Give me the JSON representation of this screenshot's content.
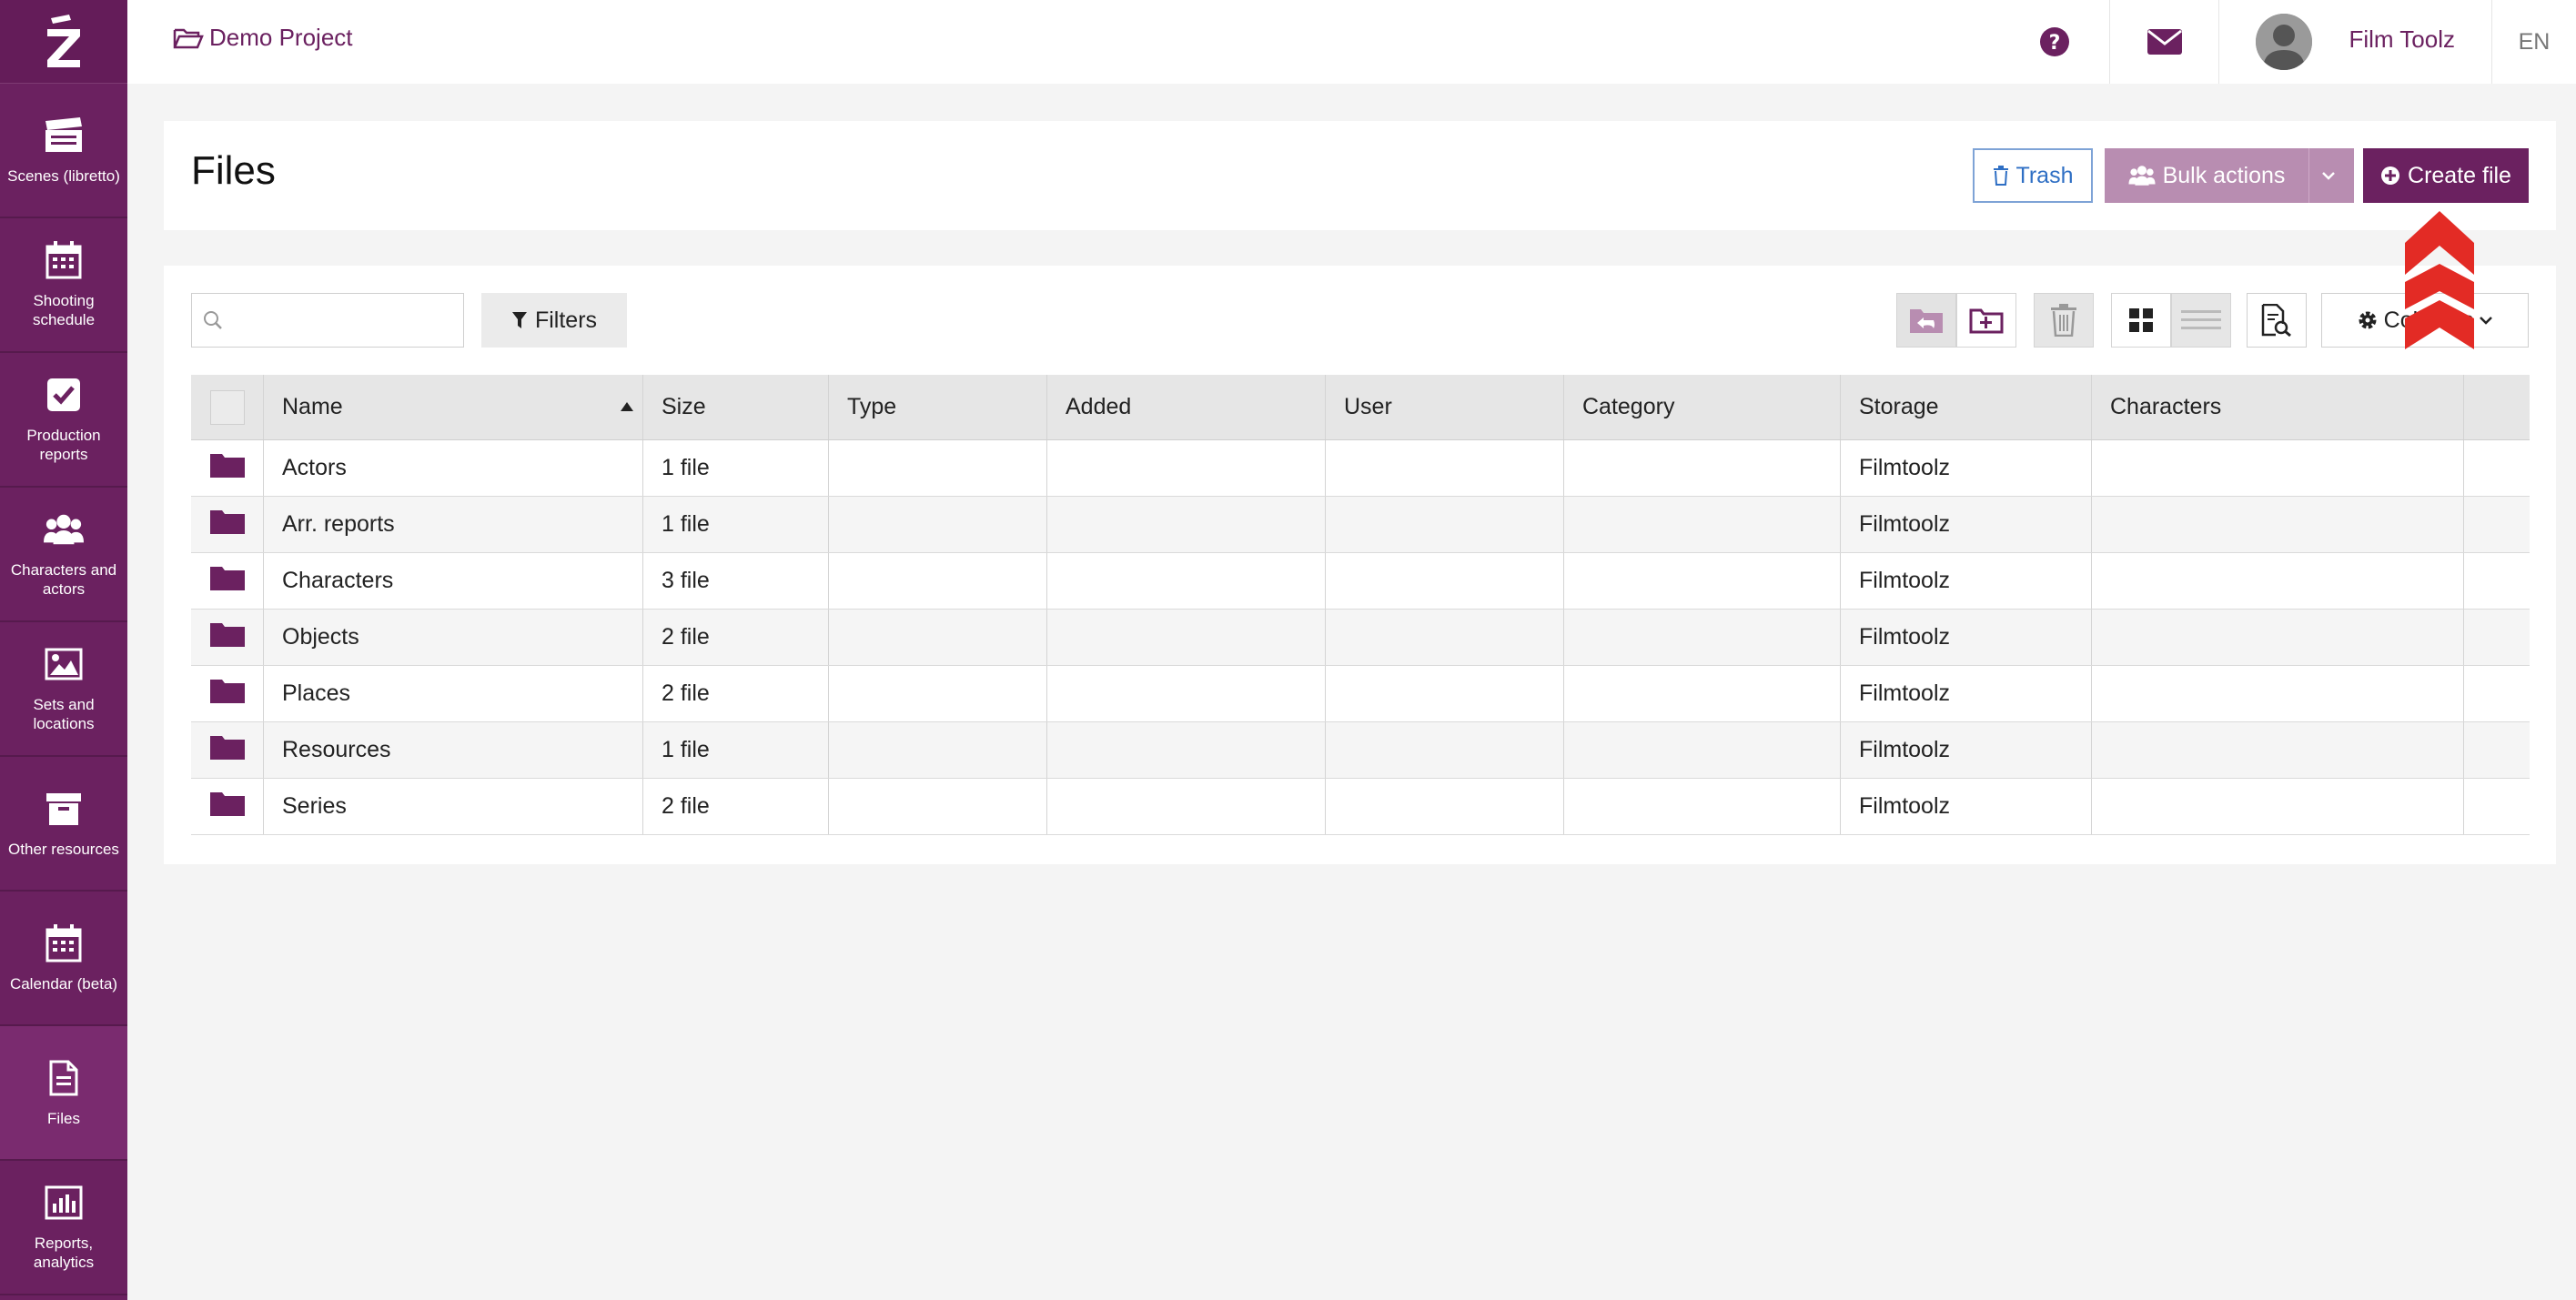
{
  "sidebar": {
    "items": [
      {
        "label": "Scenes (libretto)",
        "icon": "clapperboard-icon"
      },
      {
        "label": "Shooting schedule",
        "icon": "calendar-icon"
      },
      {
        "label": "Production reports",
        "icon": "checkbox-icon"
      },
      {
        "label": "Characters and actors",
        "icon": "users-icon"
      },
      {
        "label": "Sets and locations",
        "icon": "image-icon"
      },
      {
        "label": "Other resources",
        "icon": "archive-box-icon"
      },
      {
        "label": "Calendar (beta)",
        "icon": "calendar-icon"
      },
      {
        "label": "Files",
        "icon": "file-icon",
        "active": true
      },
      {
        "label": "Reports, analytics",
        "icon": "bar-chart-icon"
      }
    ]
  },
  "topbar": {
    "project": "Demo Project",
    "user_name": "Film Toolz",
    "language": "EN"
  },
  "header": {
    "title": "Files",
    "trash_label": "Trash",
    "bulk_actions_label": "Bulk actions",
    "create_file_label": "Create file"
  },
  "toolbar": {
    "search_placeholder": "",
    "filters_label": "Filters",
    "columns_label": "Columns"
  },
  "table": {
    "headers": [
      "Name",
      "Size",
      "Type",
      "Added",
      "User",
      "Category",
      "Storage",
      "Characters"
    ],
    "rows": [
      {
        "name": "Actors",
        "size": "1 file",
        "type": "",
        "added": "",
        "user": "",
        "category": "",
        "storage": "Filmtoolz",
        "characters": ""
      },
      {
        "name": "Arr. reports",
        "size": "1 file",
        "type": "",
        "added": "",
        "user": "",
        "category": "",
        "storage": "Filmtoolz",
        "characters": ""
      },
      {
        "name": "Characters",
        "size": "3 file",
        "type": "",
        "added": "",
        "user": "",
        "category": "",
        "storage": "Filmtoolz",
        "characters": ""
      },
      {
        "name": "Objects",
        "size": "2 file",
        "type": "",
        "added": "",
        "user": "",
        "category": "",
        "storage": "Filmtoolz",
        "characters": ""
      },
      {
        "name": "Places",
        "size": "2 file",
        "type": "",
        "added": "",
        "user": "",
        "category": "",
        "storage": "Filmtoolz",
        "characters": ""
      },
      {
        "name": "Resources",
        "size": "1 file",
        "type": "",
        "added": "",
        "user": "",
        "category": "",
        "storage": "Filmtoolz",
        "characters": ""
      },
      {
        "name": "Series",
        "size": "2 file",
        "type": "",
        "added": "",
        "user": "",
        "category": "",
        "storage": "Filmtoolz",
        "characters": ""
      }
    ]
  },
  "colors": {
    "brand": "#6b2160",
    "bulk": "#b88db1",
    "trash": "#2f6fc4",
    "annotation": "#e32b25"
  }
}
